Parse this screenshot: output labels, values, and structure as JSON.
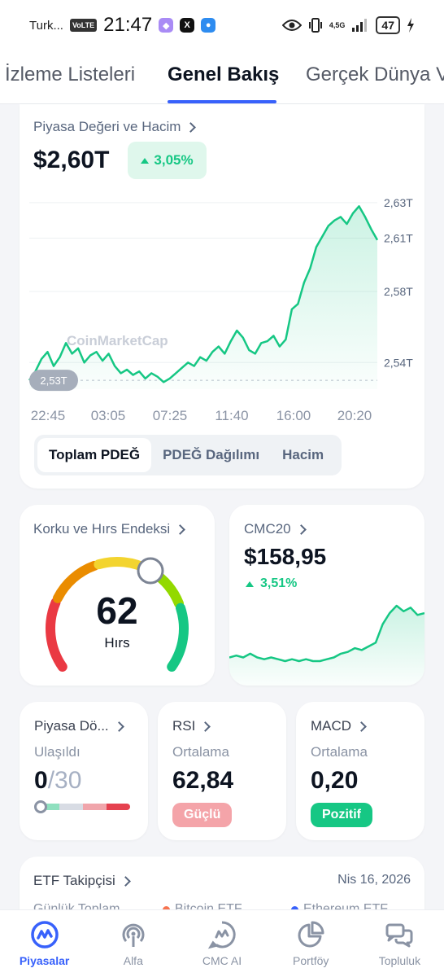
{
  "status_bar": {
    "carrier": "Turk...",
    "volte": "VoLTE",
    "time": "21:47",
    "network": "4,5G",
    "battery": "47"
  },
  "tabs": [
    {
      "label": "İzleme Listeleri"
    },
    {
      "label": "Genel Bakış"
    },
    {
      "label": "Gerçek Dünya V"
    }
  ],
  "market_card": {
    "title": "Piyasa Değeri ve Hacim",
    "value": "$2,60T",
    "change": "3,05%",
    "watermark": "CoinMarketCap",
    "segments": [
      "Toplam PDEĞ",
      "PDEĞ Dağılımı",
      "Hacim"
    ]
  },
  "chart_data": [
    {
      "type": "line",
      "title": "",
      "x": [
        "22:45",
        "03:05",
        "07:25",
        "11:40",
        "16:00",
        "20:20"
      ],
      "y_ticks": [
        "2,63T",
        "2,61T",
        "2,58T",
        "2,54T"
      ],
      "y_tick_values": [
        2.63,
        2.61,
        2.58,
        2.54
      ],
      "baseline_label": "2,53T",
      "baseline_value": 2.53,
      "ylim": [
        2.525,
        2.635
      ],
      "series": [
        {
          "values": [
            2.53,
            2.535,
            2.542,
            2.546,
            2.538,
            2.543,
            2.551,
            2.545,
            2.548,
            2.54,
            2.544,
            2.546,
            2.541,
            2.545,
            2.538,
            2.534,
            2.536,
            2.533,
            2.535,
            2.531,
            2.534,
            2.532,
            2.529,
            2.531,
            2.534,
            2.537,
            2.54,
            2.538,
            2.543,
            2.541,
            2.546,
            2.549,
            2.545,
            2.552,
            2.558,
            2.554,
            2.547,
            2.545,
            2.551,
            2.552,
            2.555,
            2.549,
            2.553,
            2.57,
            2.573,
            2.585,
            2.593,
            2.605,
            2.611,
            2.617,
            2.62,
            2.622,
            2.618,
            2.624,
            2.628,
            2.622,
            2.615,
            2.609
          ]
        }
      ],
      "color": "#16c784"
    },
    {
      "type": "line",
      "title": "CMC20",
      "series": [
        {
          "values": [
            4,
            5,
            4,
            6,
            4,
            3,
            4,
            3,
            2,
            3,
            2,
            3,
            2,
            2,
            3,
            4,
            6,
            7,
            9,
            8,
            10,
            12,
            22,
            28,
            32,
            29,
            31,
            27,
            28
          ]
        }
      ],
      "color": "#16c784"
    }
  ],
  "fear_greed": {
    "title": "Korku ve Hırs Endeksi",
    "value": "62",
    "value_num": 62,
    "label": "Hırs"
  },
  "cmc20": {
    "title": "CMC20",
    "value": "$158,95",
    "change": "3,51%"
  },
  "cycle": {
    "title": "Piyasa Dö...",
    "label": "Ulaşıldı",
    "value": "0",
    "total": "/30"
  },
  "rsi": {
    "title": "RSI",
    "label": "Ortalama",
    "value": "62,84",
    "pill": "Güçlü"
  },
  "macd": {
    "title": "MACD",
    "label": "Ortalama",
    "value": "0,20",
    "pill": "Pozitif"
  },
  "etf": {
    "title": "ETF Takipçisi",
    "date": "Nis 16, 2026",
    "row_label": "Günlük Toplam",
    "legend_btc": "Bitcoin ETF",
    "legend_eth": "Ethereum ETF"
  },
  "bottom_nav": [
    {
      "label": "Piyasalar",
      "icon": "markets-icon"
    },
    {
      "label": "Alfa",
      "icon": "alpha-icon"
    },
    {
      "label": "CMC AI",
      "icon": "cmc-ai-icon"
    },
    {
      "label": "Portföy",
      "icon": "portfolio-icon"
    },
    {
      "label": "Topluluk",
      "icon": "community-icon"
    }
  ],
  "colors": {
    "accent": "#3861fb",
    "positive": "#16c784",
    "negative": "#ea3943"
  }
}
